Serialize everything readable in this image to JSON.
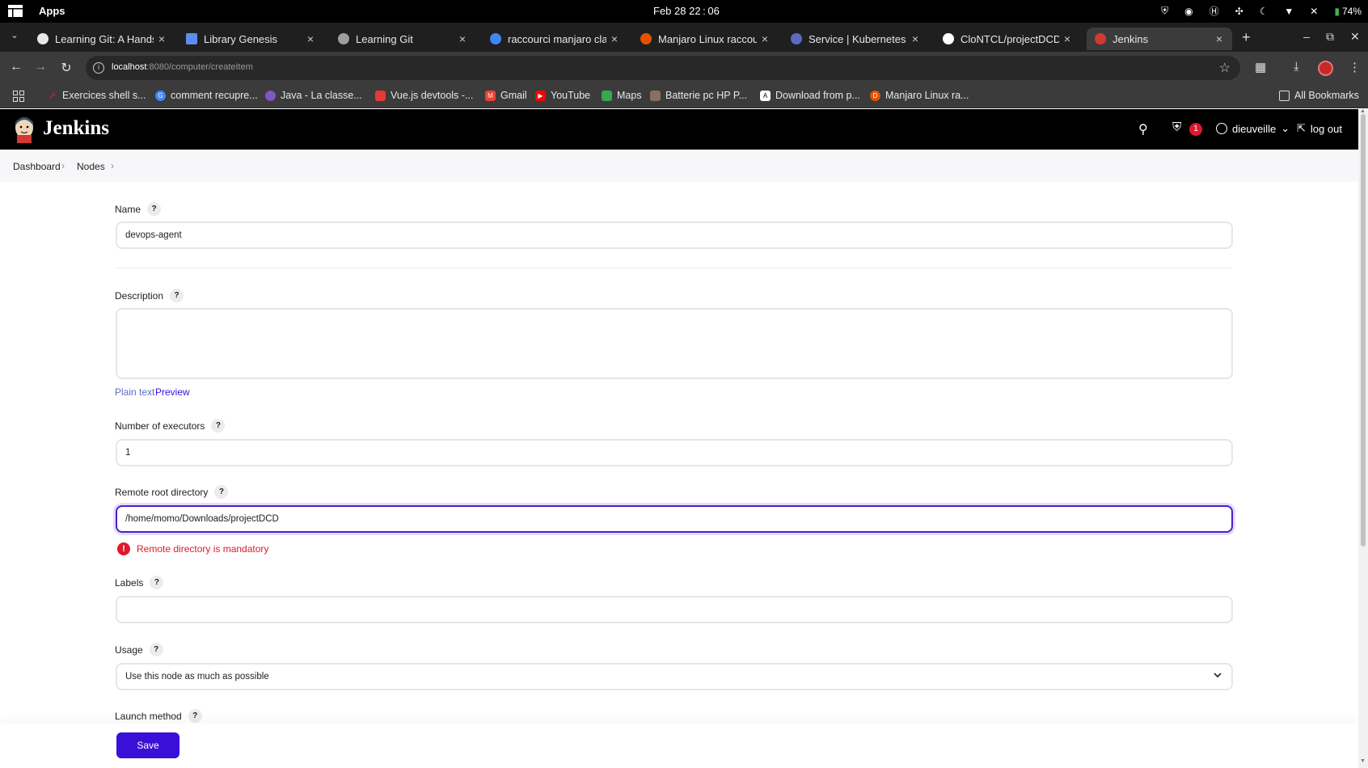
{
  "os_bar": {
    "apps_label": "Apps",
    "clock": "Feb 28  22 : 06",
    "battery": "74%"
  },
  "tabs": [
    {
      "title": "Learning Git: A Hands-On",
      "favicon_color": "#e8e8e8",
      "active": false
    },
    {
      "title": "Library Genesis",
      "favicon_color": "#5b8def",
      "active": false
    },
    {
      "title": "Learning Git",
      "favicon_color": "#9e9e9e",
      "active": false
    },
    {
      "title": "raccourci manjaro clavier",
      "favicon_color": "#4285f4",
      "active": false
    },
    {
      "title": "Manjaro Linux raccourci",
      "favicon_color": "#e65100",
      "active": false
    },
    {
      "title": "Service | Kubernetes",
      "favicon_color": "#5c6bc0",
      "active": false
    },
    {
      "title": "CloNTCL/projectDCD",
      "favicon_color": "#ffffff",
      "active": false
    },
    {
      "title": "Jenkins",
      "favicon_color": "#d33833",
      "active": true
    }
  ],
  "address_bar": {
    "host": "localhost",
    "path": ":8080/computer/createItem"
  },
  "bookmarks": [
    {
      "label": "Exercices shell s...",
      "icon_color": "#e0182d"
    },
    {
      "label": "comment recupre...",
      "icon_color": "#4285f4"
    },
    {
      "label": "Java - La classe...",
      "icon_color": "#7e57c2"
    },
    {
      "label": "Vue.js devtools -...",
      "icon_color": "#e53935"
    },
    {
      "label": "Gmail",
      "icon_color": "#ea4335"
    },
    {
      "label": "YouTube",
      "icon_color": "#ff0000"
    },
    {
      "label": "Maps",
      "icon_color": "#34a853"
    },
    {
      "label": "Batterie pc HP P...",
      "icon_color": "#8d6e63"
    },
    {
      "label": "Download from p...",
      "icon_color": "#ffffff"
    },
    {
      "label": "Manjaro Linux ra...",
      "icon_color": "#e65100"
    }
  ],
  "all_bookmarks_label": "All Bookmarks",
  "jenkins": {
    "title": "Jenkins",
    "security_badge_count": "1",
    "username": "dieuveille",
    "logout_label": "log out"
  },
  "breadcrumb": [
    "Dashboard",
    "Nodes"
  ],
  "form": {
    "name_label": "Name",
    "name_value": "devops-agent",
    "description_label": "Description",
    "description_value": "",
    "plain_text_label": "Plain text",
    "preview_label": "Preview",
    "executors_label": "Number of executors",
    "executors_value": "1",
    "remote_root_label": "Remote root directory",
    "remote_root_value": "/home/momo/Downloads/projectDCD",
    "remote_root_error": "Remote directory is mandatory",
    "labels_label": "Labels",
    "labels_value": "",
    "usage_label": "Usage",
    "usage_value": "Use this node as much as possible",
    "launch_method_label": "Launch method",
    "save_label": "Save"
  },
  "colors": {
    "accent": "#3a10d8",
    "error": "#e0182d",
    "header_bg": "#000000"
  }
}
